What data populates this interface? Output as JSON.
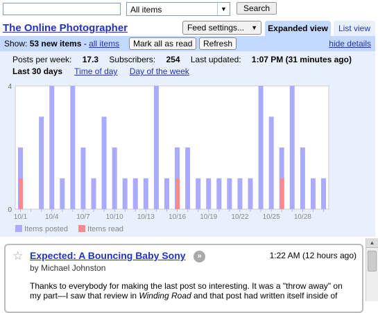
{
  "search": {
    "input_value": "",
    "scope_value": "All items",
    "button_label": "Search"
  },
  "header": {
    "feed_title": "The Online Photographer",
    "feed_settings_label": "Feed settings...",
    "tab_expanded": "Expanded view",
    "tab_list": "List view"
  },
  "toolbar": {
    "show_prefix": "Show:",
    "new_items": "53 new items",
    "separator": " - ",
    "all_items_link": "all items",
    "mark_all_read": "Mark all as read",
    "refresh": "Refresh",
    "hide_details": "hide details"
  },
  "details": {
    "posts_per_week_label": "Posts per week:",
    "posts_per_week_value": "17.3",
    "subscribers_label": "Subscribers:",
    "subscribers_value": "254",
    "last_updated_label": "Last updated:",
    "last_updated_value": "1:07 PM (31 minutes ago)",
    "period_active": "Last 30 days",
    "period_time_of_day": "Time of day",
    "period_day_of_week": "Day of the week"
  },
  "chart_data": {
    "type": "bar",
    "categories": [
      "10/1",
      "",
      "",
      "10/4",
      "",
      "",
      "10/7",
      "",
      "",
      "10/10",
      "",
      "",
      "10/13",
      "",
      "",
      "10/16",
      "",
      "",
      "10/19",
      "",
      "",
      "10/22",
      "",
      "",
      "10/25",
      "",
      "",
      "10/28",
      "",
      ""
    ],
    "series": [
      {
        "name": "Items posted",
        "color": "#aaaaff",
        "values": [
          2,
          0,
          3,
          4,
          1,
          4,
          2,
          1,
          3,
          2,
          1,
          1,
          1,
          4,
          1,
          2,
          2,
          1,
          1,
          1,
          1,
          1,
          1,
          4,
          3,
          2,
          4,
          2,
          1,
          1
        ]
      },
      {
        "name": "Items read",
        "color": "#ff8888",
        "values": [
          1,
          0,
          0,
          0,
          0,
          0,
          0,
          0,
          0,
          0,
          0,
          0,
          0,
          0,
          0,
          1,
          0,
          0,
          0,
          0,
          0,
          0,
          0,
          0,
          0,
          1,
          0,
          0,
          0,
          0
        ]
      }
    ],
    "ylim": [
      0,
      4
    ],
    "y_ticks": [
      "0",
      "4"
    ],
    "legend_placement": "bottom-left"
  },
  "entry": {
    "star_icon": "star-icon",
    "title": "Expected: A Bouncing Baby Sony",
    "share_icon": "share-arrow-icon",
    "time": "1:22 AM (12 hours ago)",
    "author": "by Michael Johnston",
    "body_line1": "Thanks to everybody for making the last post so interesting. It was a \"throw away\" on",
    "body_line2_a": "my part—I saw that review in ",
    "body_line2_italic": "Winding Road",
    "body_line2_b": " and that post had written itself inside of"
  }
}
